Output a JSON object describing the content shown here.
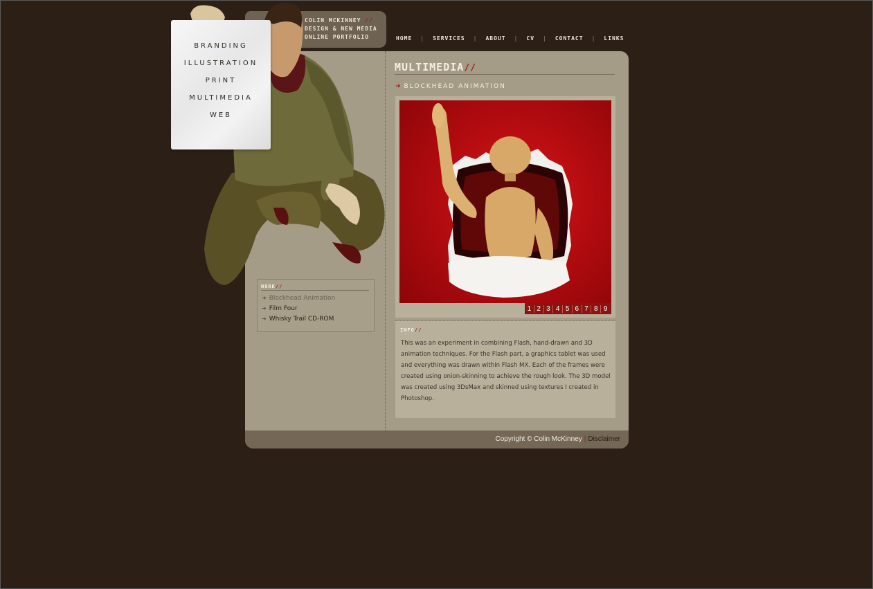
{
  "logo": {
    "line1": "COLIN MCKINNEY",
    "slash": "//",
    "line2": "DESIGN & NEW MEDIA",
    "line3": "ONLINE PORTFOLIO"
  },
  "top_nav": [
    "HOME",
    "SERVICES",
    "ABOUT",
    "CV",
    "CONTACT",
    "LINKS"
  ],
  "top_nav_separator": "|",
  "paper_menu": [
    "BRANDING",
    "ILLUSTRATION",
    "PRINT",
    "MULTIMEDIA",
    "WEB"
  ],
  "section": {
    "title": "MULTIMEDIA",
    "slash": "//",
    "subtitle_arrow": "➜",
    "subtitle": "BLOCKHEAD ANIMATION"
  },
  "pager": [
    "1",
    "2",
    "3",
    "4",
    "5",
    "6",
    "7",
    "8",
    "9"
  ],
  "info": {
    "label": "INFO",
    "slash": "//",
    "text": "This was an experiment in combining Flash, hand-drawn and 3D animation techniques. For the Flash part, a graphics tablet was used and everything was drawn within Flash MX. Each of the frames were created using onion-skinning to achieve the rough look. The 3D model was created using 3DsMax and skinned using textures I created in Photoshop."
  },
  "work": {
    "label": "WORK",
    "slash": "//",
    "arrow": "➜",
    "items": [
      {
        "label": "Blockhead Animation",
        "active": true
      },
      {
        "label": "Film Four",
        "active": false
      },
      {
        "label": "Whisky Trail CD-ROM",
        "active": false
      }
    ]
  },
  "footer": {
    "copyright": "Copyright © Colin McKinney",
    "separator": "|",
    "disclaimer": "Disclaimer"
  },
  "colors": {
    "background": "#2c1f16",
    "panel": "#a59c88",
    "accent_red": "#a21c14",
    "footer": "#746756"
  }
}
